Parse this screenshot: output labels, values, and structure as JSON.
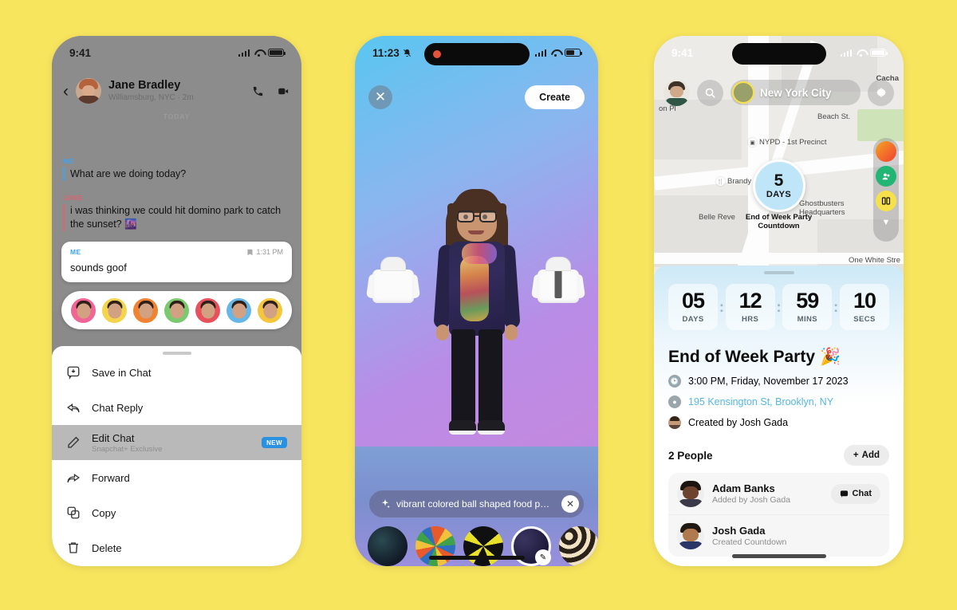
{
  "background_color": "#F8E55E",
  "phone1": {
    "name": "snapchat-chat-edit-message",
    "status": {
      "time": "9:41"
    },
    "header": {
      "back_icon": "chevron-left-icon",
      "contact_name": "Jane Bradley",
      "contact_meta": "Williamsburg, NYC · 2m",
      "call_icon": "phone-call-icon",
      "video_icon": "video-camera-icon"
    },
    "divider_label": "TODAY",
    "messages": [
      {
        "sender": "ME",
        "text": "What are we doing today?",
        "color": "#3fa4f0"
      },
      {
        "sender": "JANE",
        "text": "i was thinking we could hit domino park to catch the sunset? 🌆",
        "color": "#e0616f"
      }
    ],
    "selected_message": {
      "sender": "ME",
      "time": "1:31 PM",
      "status_icon": "saved-icon",
      "text": "sounds goof"
    },
    "reactions": [
      {
        "name": "heart-reaction",
        "color": "#f06595"
      },
      {
        "name": "sun-reaction",
        "color": "#f4d44d"
      },
      {
        "name": "fire-reaction",
        "color": "#f08232"
      },
      {
        "name": "thumbs-up-reaction",
        "color": "#7bc96f"
      },
      {
        "name": "cry-reaction",
        "color": "#e8505b"
      },
      {
        "name": "cool-reaction",
        "color": "#66b6e8"
      },
      {
        "name": "party-reaction",
        "color": "#f3c63c"
      }
    ],
    "menu": [
      {
        "label": "Save in Chat",
        "sub": "",
        "icon": "save-chat-icon",
        "badge": "",
        "highlighted": false
      },
      {
        "label": "Chat Reply",
        "sub": "",
        "icon": "reply-icon",
        "badge": "",
        "highlighted": false
      },
      {
        "label": "Edit Chat",
        "sub": "Snapchat+ Exclusive",
        "icon": "pencil-icon",
        "badge": "NEW",
        "highlighted": true
      },
      {
        "label": "Forward",
        "sub": "",
        "icon": "forward-icon",
        "badge": "",
        "highlighted": false
      },
      {
        "label": "Copy",
        "sub": "",
        "icon": "copy-icon",
        "badge": "",
        "highlighted": false
      },
      {
        "label": "Delete",
        "sub": "",
        "icon": "trash-icon",
        "badge": "",
        "highlighted": false
      }
    ]
  },
  "phone2": {
    "name": "bitmoji-ai-outfit-creator",
    "status": {
      "time": "11:23",
      "mute_icon": "bell-slash-icon"
    },
    "close_label": "✕",
    "create_label": "Create",
    "prompt": {
      "sparkle_icon": "sparkles-icon",
      "text": "vibrant colored ball shaped food p…",
      "clear_icon": "close-circle-icon"
    },
    "thumbnails": [
      {
        "name": "thumb-dark-floral",
        "selected": false
      },
      {
        "name": "thumb-colorful-confetti",
        "selected": false
      },
      {
        "name": "thumb-yellow-crowns",
        "selected": false
      },
      {
        "name": "thumb-planets-selected",
        "selected": true
      },
      {
        "name": "thumb-gold-spheres",
        "selected": false
      }
    ],
    "garments": [
      {
        "name": "white-hoodie-left"
      },
      {
        "name": "white-zip-hoodie-right"
      }
    ]
  },
  "phone3": {
    "name": "snap-map-countdown-event",
    "status": {
      "time": "9:41"
    },
    "map": {
      "city_label": "New York City",
      "search_icon": "search-icon",
      "gear_icon": "gear-icon",
      "profile_icon": "bitmoji-avatar-icon",
      "labels": [
        "Cacha",
        "on Pl",
        "Beach St.",
        "NYPD - 1st Precinct",
        "Brandy",
        "Belle Reve",
        "Ghostbusters Headquarters",
        "One White Stre"
      ],
      "marker": {
        "number": "5",
        "unit": "DAYS"
      },
      "marker_caption_line1": "End of Week Party",
      "marker_caption_line2": "Countdown",
      "rail_buttons": [
        {
          "name": "heat-map-button",
          "color": "#ef5a3c"
        },
        {
          "name": "friends-button",
          "color": "#22b573"
        },
        {
          "name": "places-button",
          "color": "#f7e14a"
        }
      ],
      "rail_chevron_icon": "chevron-down-icon"
    },
    "countdown": [
      {
        "value": "05",
        "unit": "DAYS"
      },
      {
        "value": "12",
        "unit": "HRS"
      },
      {
        "value": "59",
        "unit": "MINS"
      },
      {
        "value": "10",
        "unit": "SECS"
      }
    ],
    "event": {
      "title": "End of Week Party",
      "title_emoji": "🎉",
      "time_icon": "clock-icon",
      "time": "3:00 PM, Friday, November 17 2023",
      "location_icon": "map-pin-icon",
      "location": "195 Kensington St, Brooklyn, NY",
      "creator_icon": "avatar-icon",
      "creator": "Created by Josh Gada"
    },
    "people_section": {
      "title": "2 People",
      "add_label": "Add",
      "add_icon": "plus-icon",
      "people": [
        {
          "name": "Adam Banks",
          "sub": "Added by Josh Gada",
          "action_label": "Chat",
          "action_icon": "chat-bubble-icon",
          "hair": "#1b1410",
          "skin": "#6d4330",
          "body": "#3a3a48"
        },
        {
          "name": "Josh Gada",
          "sub": "Created Countdown",
          "action_label": "",
          "action_icon": "",
          "hair": "#201812",
          "skin": "#b07a4e",
          "body": "#2b3566"
        }
      ]
    }
  }
}
